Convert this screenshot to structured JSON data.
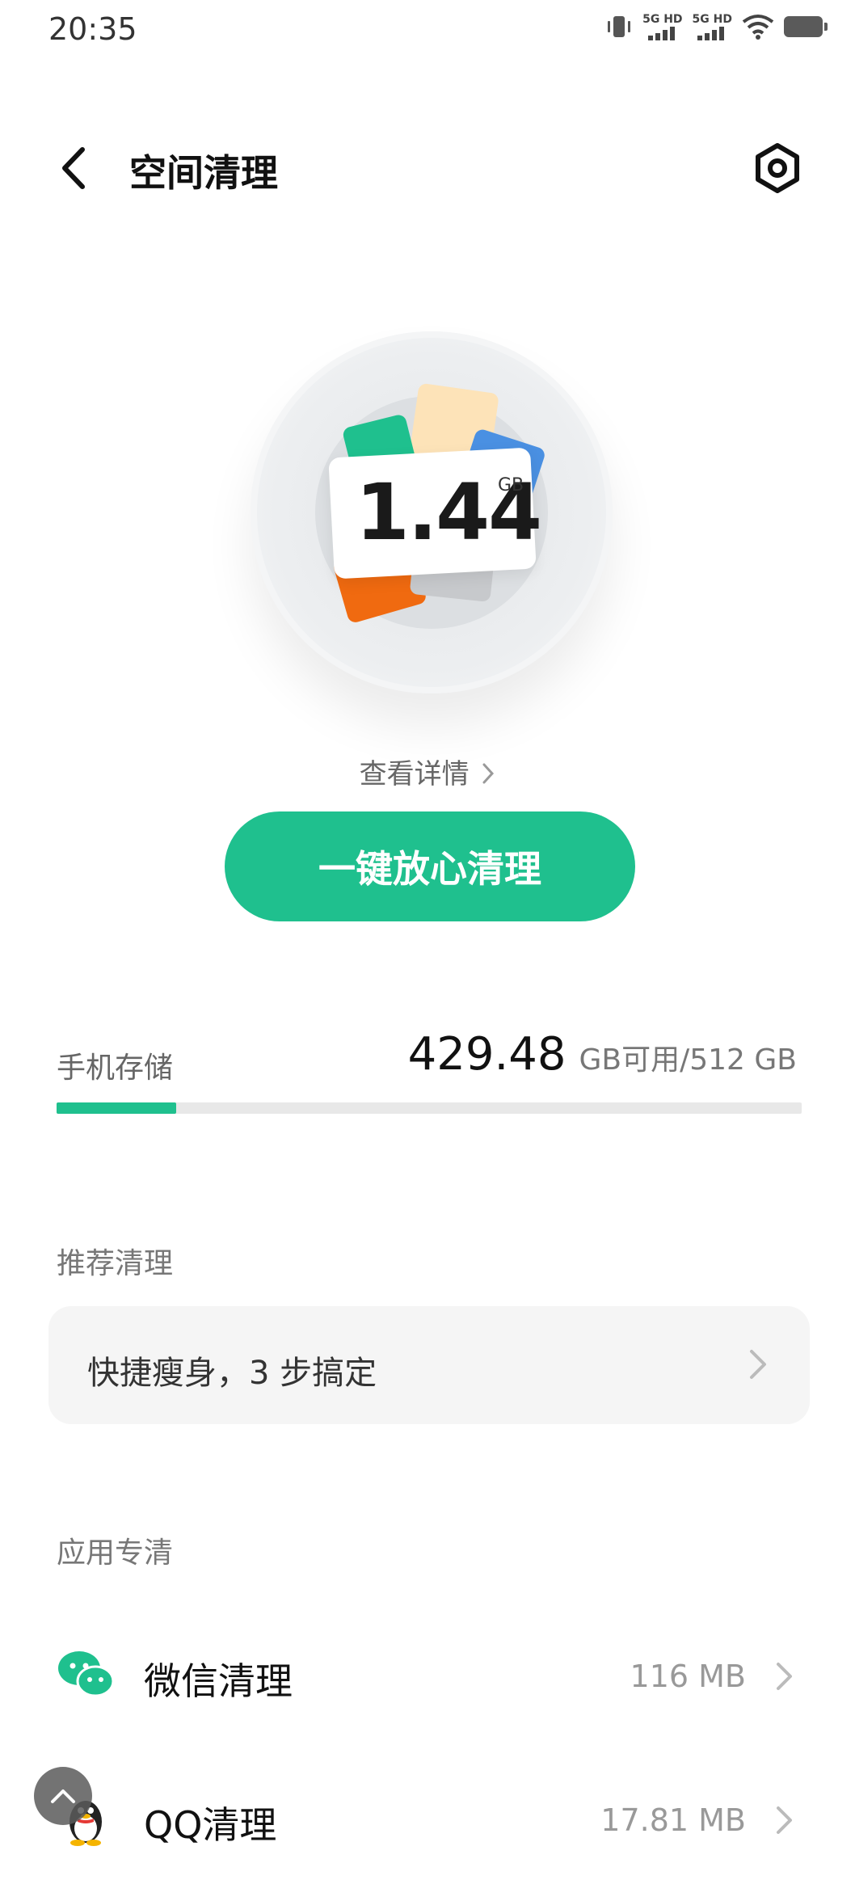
{
  "status_bar": {
    "time": "20:35",
    "net1": "5G HD",
    "net2": "5G HD"
  },
  "header": {
    "title": "空间清理",
    "back_icon": "chevron-left-icon",
    "settings_icon": "settings-icon"
  },
  "hero": {
    "value": "1.44",
    "unit": "GB",
    "details_link": "查看详情"
  },
  "primary_action": {
    "label": "一键放心清理",
    "color": "#1fc08e"
  },
  "storage": {
    "label": "手机存储",
    "available": "429.48",
    "suffix": "GB可用/512 GB",
    "used_fraction": 0.161
  },
  "recommended": {
    "section_label": "推荐清理",
    "card_label": "快捷瘦身，3 步搞定"
  },
  "apps": {
    "section_label": "应用专清",
    "items": [
      {
        "name": "微信清理",
        "size": "116 MB",
        "icon": "wechat-icon"
      },
      {
        "name": "QQ清理",
        "size": "17.81 MB",
        "icon": "qq-icon"
      }
    ]
  }
}
